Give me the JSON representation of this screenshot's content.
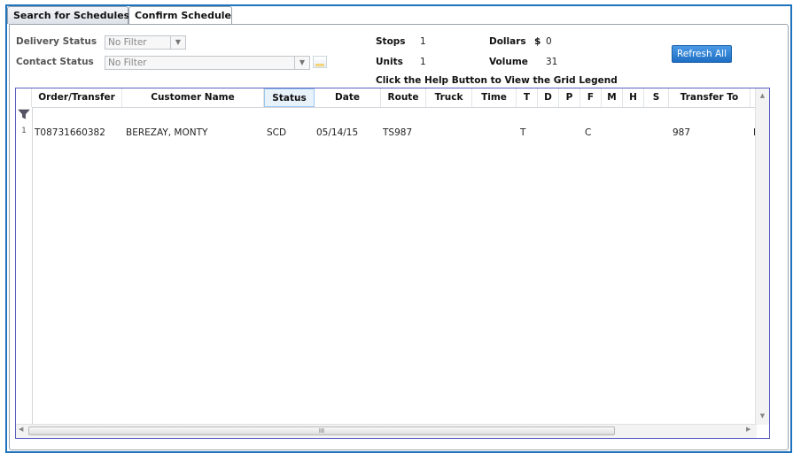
{
  "tabs": [
    {
      "label": "Search for Schedules",
      "active": false
    },
    {
      "label": "Confirm Schedule",
      "active": true
    }
  ],
  "filters": {
    "delivery_status_label": "Delivery Status",
    "delivery_status_value": "No Filter",
    "contact_status_label": "Contact Status",
    "contact_status_value": "No Filter"
  },
  "summary": {
    "stops_label": "Stops",
    "stops_value": "1",
    "units_label": "Units",
    "units_value": "1",
    "dollars_label": "Dollars",
    "dollars_symbol": "$",
    "dollars_value": "0",
    "volume_label": "Volume",
    "volume_value": "31",
    "help_text": "Click the Help Button to View the Grid Legend"
  },
  "refresh_label": "Refresh All",
  "grid": {
    "columns": [
      "Order/Transfer",
      "Customer Name",
      "Status",
      "Date",
      "Route",
      "Truck",
      "Time",
      "T",
      "D",
      "P",
      "F",
      "M",
      "H",
      "S",
      "Transfer To"
    ],
    "rows": [
      {
        "row_number": "1",
        "order_transfer": "T08731660382",
        "customer_name": "BEREZAY, MONTY",
        "status": "SCD",
        "date": "05/14/15",
        "route": "TS987",
        "truck": "",
        "time": "",
        "t": "T",
        "d": "",
        "p": "",
        "f": "C",
        "m": "",
        "h": "",
        "s": "",
        "transfer_to": "987",
        "overflow_char": "I"
      }
    ],
    "hscroll_grip": "III"
  },
  "colors": {
    "frame_border": "#1e73be",
    "grid_border": "#5a5fc0",
    "button_blue": "#2a7fd4"
  }
}
